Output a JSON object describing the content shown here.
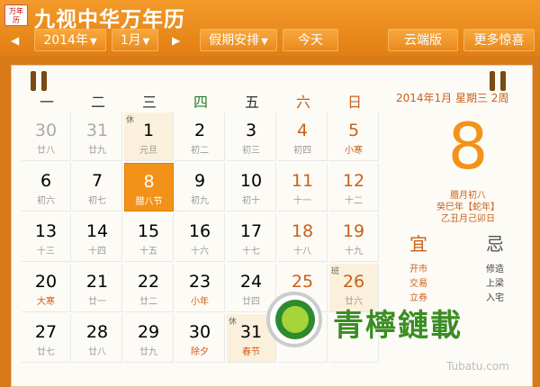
{
  "app": {
    "logo_line1": "万年",
    "logo_line2": "历",
    "title": "九视中华万年历"
  },
  "toolbar": {
    "prev": "◀",
    "next": "▶",
    "year": "2014年",
    "month": "1月",
    "holiday": "假期安排",
    "today": "今天",
    "cloud": "云端版",
    "more": "更多惊喜"
  },
  "weekdays": [
    "一",
    "二",
    "三",
    "四",
    "五",
    "六",
    "日"
  ],
  "rows": [
    [
      {
        "d": "30",
        "l": "廿八",
        "c": "grey"
      },
      {
        "d": "31",
        "l": "廿九",
        "c": "grey"
      },
      {
        "d": "1",
        "l": "元旦",
        "c": "holiday",
        "t": "休"
      },
      {
        "d": "2",
        "l": "初二",
        "c": ""
      },
      {
        "d": "3",
        "l": "初三",
        "c": ""
      },
      {
        "d": "4",
        "l": "初四",
        "c": "weekend"
      },
      {
        "d": "5",
        "l": "小寒",
        "c": "weekend festival"
      }
    ],
    [
      {
        "d": "6",
        "l": "初六",
        "c": ""
      },
      {
        "d": "7",
        "l": "初七",
        "c": ""
      },
      {
        "d": "8",
        "l": "腊八节",
        "c": "sel"
      },
      {
        "d": "9",
        "l": "初九",
        "c": ""
      },
      {
        "d": "10",
        "l": "初十",
        "c": ""
      },
      {
        "d": "11",
        "l": "十一",
        "c": "weekend"
      },
      {
        "d": "12",
        "l": "十二",
        "c": "weekend"
      }
    ],
    [
      {
        "d": "13",
        "l": "十三",
        "c": ""
      },
      {
        "d": "14",
        "l": "十四",
        "c": ""
      },
      {
        "d": "15",
        "l": "十五",
        "c": ""
      },
      {
        "d": "16",
        "l": "十六",
        "c": ""
      },
      {
        "d": "17",
        "l": "十七",
        "c": ""
      },
      {
        "d": "18",
        "l": "十八",
        "c": "weekend"
      },
      {
        "d": "19",
        "l": "十九",
        "c": "weekend"
      }
    ],
    [
      {
        "d": "20",
        "l": "大寒",
        "c": "festival"
      },
      {
        "d": "21",
        "l": "廿一",
        "c": ""
      },
      {
        "d": "22",
        "l": "廿二",
        "c": ""
      },
      {
        "d": "23",
        "l": "小年",
        "c": "festival"
      },
      {
        "d": "24",
        "l": "廿四",
        "c": ""
      },
      {
        "d": "25",
        "l": "廿五",
        "c": "weekend"
      },
      {
        "d": "26",
        "l": "廿六",
        "c": "weekend holiday",
        "t": "班"
      }
    ],
    [
      {
        "d": "27",
        "l": "廿七",
        "c": ""
      },
      {
        "d": "28",
        "l": "廿八",
        "c": ""
      },
      {
        "d": "29",
        "l": "廿九",
        "c": ""
      },
      {
        "d": "30",
        "l": "除夕",
        "c": "festival"
      },
      {
        "d": "31",
        "l": "春节",
        "c": "holiday festival",
        "t": "休"
      },
      {
        "d": "",
        "l": "",
        "c": ""
      },
      {
        "d": "",
        "l": "",
        "c": ""
      }
    ]
  ],
  "detail": {
    "header": "2014年1月  星期三  2周",
    "day": "8",
    "lunar1": "腊月初八",
    "lunar2": "癸巳年【蛇年】",
    "lunar3": "乙丑月己卯日",
    "yi": "宜",
    "ji": "忌",
    "yi_items": [
      "开市",
      "交易",
      "立券"
    ],
    "ji_items": [
      "修造",
      "上梁",
      "入宅"
    ]
  },
  "watermark": {
    "text": "青檸鏈載",
    "url": "Tubatu.com"
  }
}
